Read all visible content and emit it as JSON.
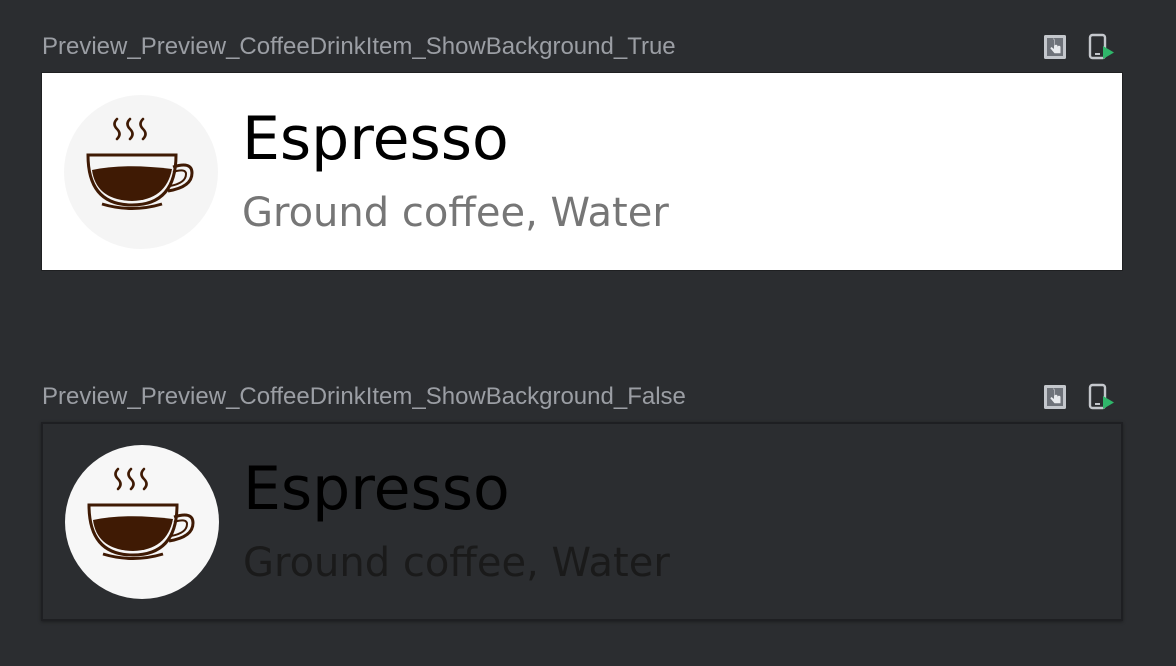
{
  "previews": [
    {
      "name": "Preview_Preview_CoffeeDrinkItem_ShowBackground_True",
      "drink": {
        "name": "Espresso",
        "ingredients": "Ground coffee, Water",
        "image_icon": "coffee-cup-icon"
      },
      "actions": {
        "interactive_icon": "interactive-mode-icon",
        "deploy_icon": "deploy-to-device-icon"
      }
    },
    {
      "name": "Preview_Preview_CoffeeDrinkItem_ShowBackground_False",
      "drink": {
        "name": "Espresso",
        "ingredients": "Ground coffee, Water",
        "image_icon": "coffee-cup-icon"
      },
      "actions": {
        "interactive_icon": "interactive-mode-icon",
        "deploy_icon": "deploy-to-device-icon"
      }
    }
  ],
  "colors": {
    "ide_background": "#2b2d30",
    "header_text": "#9b9ea4",
    "deploy_accent": "#2fb66a",
    "coffee": "#3f1a04"
  }
}
